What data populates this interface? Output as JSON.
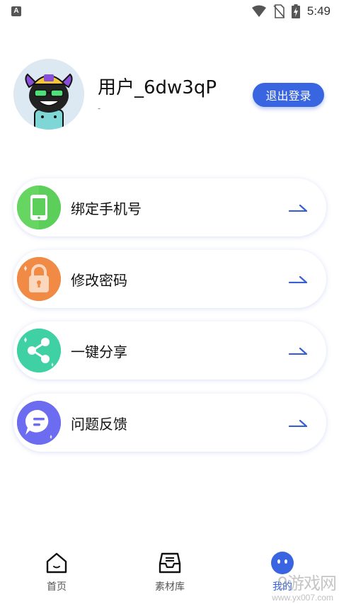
{
  "status_bar": {
    "time": "5:49",
    "app_icon": "A",
    "icons": [
      "wifi-icon",
      "no-sim-icon",
      "battery-charging-icon"
    ]
  },
  "profile": {
    "username": "用户_6dw3qP",
    "subline": "-",
    "logout_label": "退出登录",
    "accent_color": "#3966e0"
  },
  "menu": {
    "items": [
      {
        "label": "绑定手机号",
        "icon": "phone-icon",
        "color": "#5ccf5a"
      },
      {
        "label": "修改密码",
        "icon": "lock-icon",
        "color": "#f08a45"
      },
      {
        "label": "一键分享",
        "icon": "share-icon",
        "color": "#3fd0a4"
      },
      {
        "label": "问题反馈",
        "icon": "feedback-icon",
        "color": "#6c6cf0"
      }
    ]
  },
  "bottom_nav": {
    "items": [
      {
        "label": "首页",
        "icon": "home-icon",
        "active": false
      },
      {
        "label": "素材库",
        "icon": "inbox-icon",
        "active": false
      },
      {
        "label": "我的",
        "icon": "profile-face-icon",
        "active": true
      }
    ]
  },
  "watermark": {
    "text": "9游戏网",
    "url": "www.yx007.com"
  }
}
